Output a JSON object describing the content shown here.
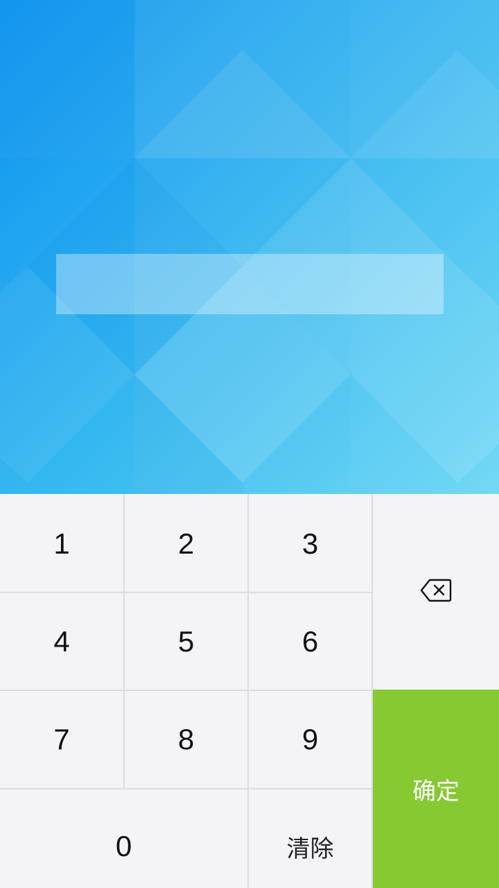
{
  "keypad": {
    "digits": [
      "1",
      "2",
      "3",
      "4",
      "5",
      "6",
      "7",
      "8",
      "9",
      "0"
    ],
    "clear_label": "清除",
    "confirm_label": "确定",
    "confirm_color": "#86c933",
    "backspace_icon": "backspace-icon"
  },
  "background": {
    "gradient_start": "#0a93ef",
    "gradient_end": "#5fd4f3"
  }
}
